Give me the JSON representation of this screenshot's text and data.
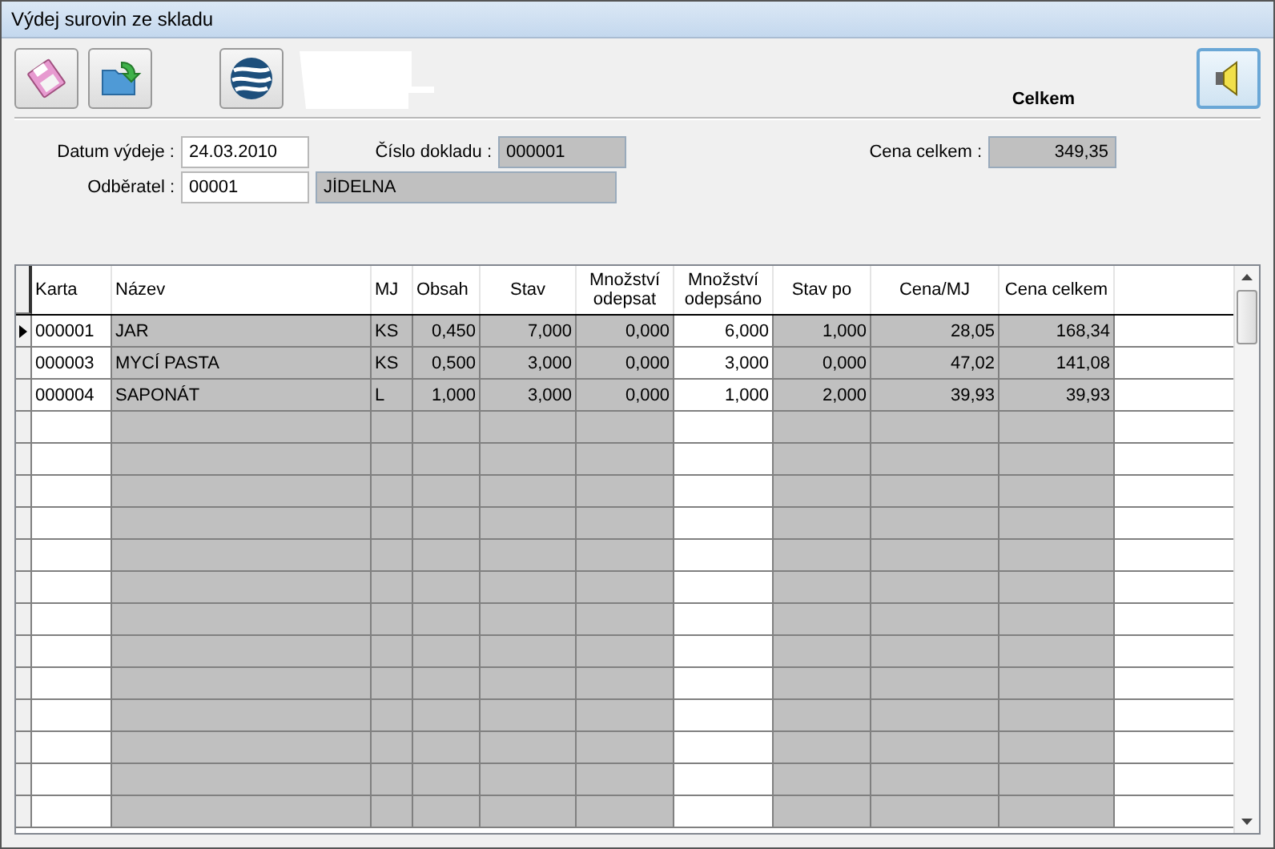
{
  "window": {
    "title": "Výdej surovin ze skladu"
  },
  "toolbar": {
    "total_label": "Celkem"
  },
  "form": {
    "date_label": "Datum výdeje :",
    "date": "24.03.2010",
    "doc_label": "Číslo dokladu :",
    "doc": "000001",
    "customer_label": "Odběratel :",
    "customer_code": "00001",
    "customer_name": "JÍDELNA",
    "total_label": "Cena celkem :",
    "total": "349,35"
  },
  "table": {
    "columns": [
      {
        "label": "Karta",
        "editable": true
      },
      {
        "label": "Název",
        "editable": false
      },
      {
        "label": "MJ",
        "editable": false
      },
      {
        "label": "Obsah",
        "editable": false
      },
      {
        "label": "Stav",
        "editable": false
      },
      {
        "label": "Množství odepsat",
        "editable": false
      },
      {
        "label": "Množství odepsáno",
        "editable": true
      },
      {
        "label": "Stav po",
        "editable": false
      },
      {
        "label": "Cena/MJ",
        "editable": false
      },
      {
        "label": "Cena celkem",
        "editable": false
      }
    ],
    "rows": [
      {
        "selected": true,
        "cells": [
          "000001",
          "JAR",
          "KS",
          "0,450",
          "7,000",
          "0,000",
          "6,000",
          "1,000",
          "28,05",
          "168,34"
        ]
      },
      {
        "selected": false,
        "cells": [
          "000003",
          "MYCÍ PASTA",
          "KS",
          "0,500",
          "3,000",
          "0,000",
          "3,000",
          "0,000",
          "47,02",
          "141,08"
        ]
      },
      {
        "selected": false,
        "cells": [
          "000004",
          "SAPONÁT",
          "L",
          "1,000",
          "3,000",
          "0,000",
          "1,000",
          "2,000",
          "39,93",
          "39,93"
        ]
      }
    ]
  }
}
